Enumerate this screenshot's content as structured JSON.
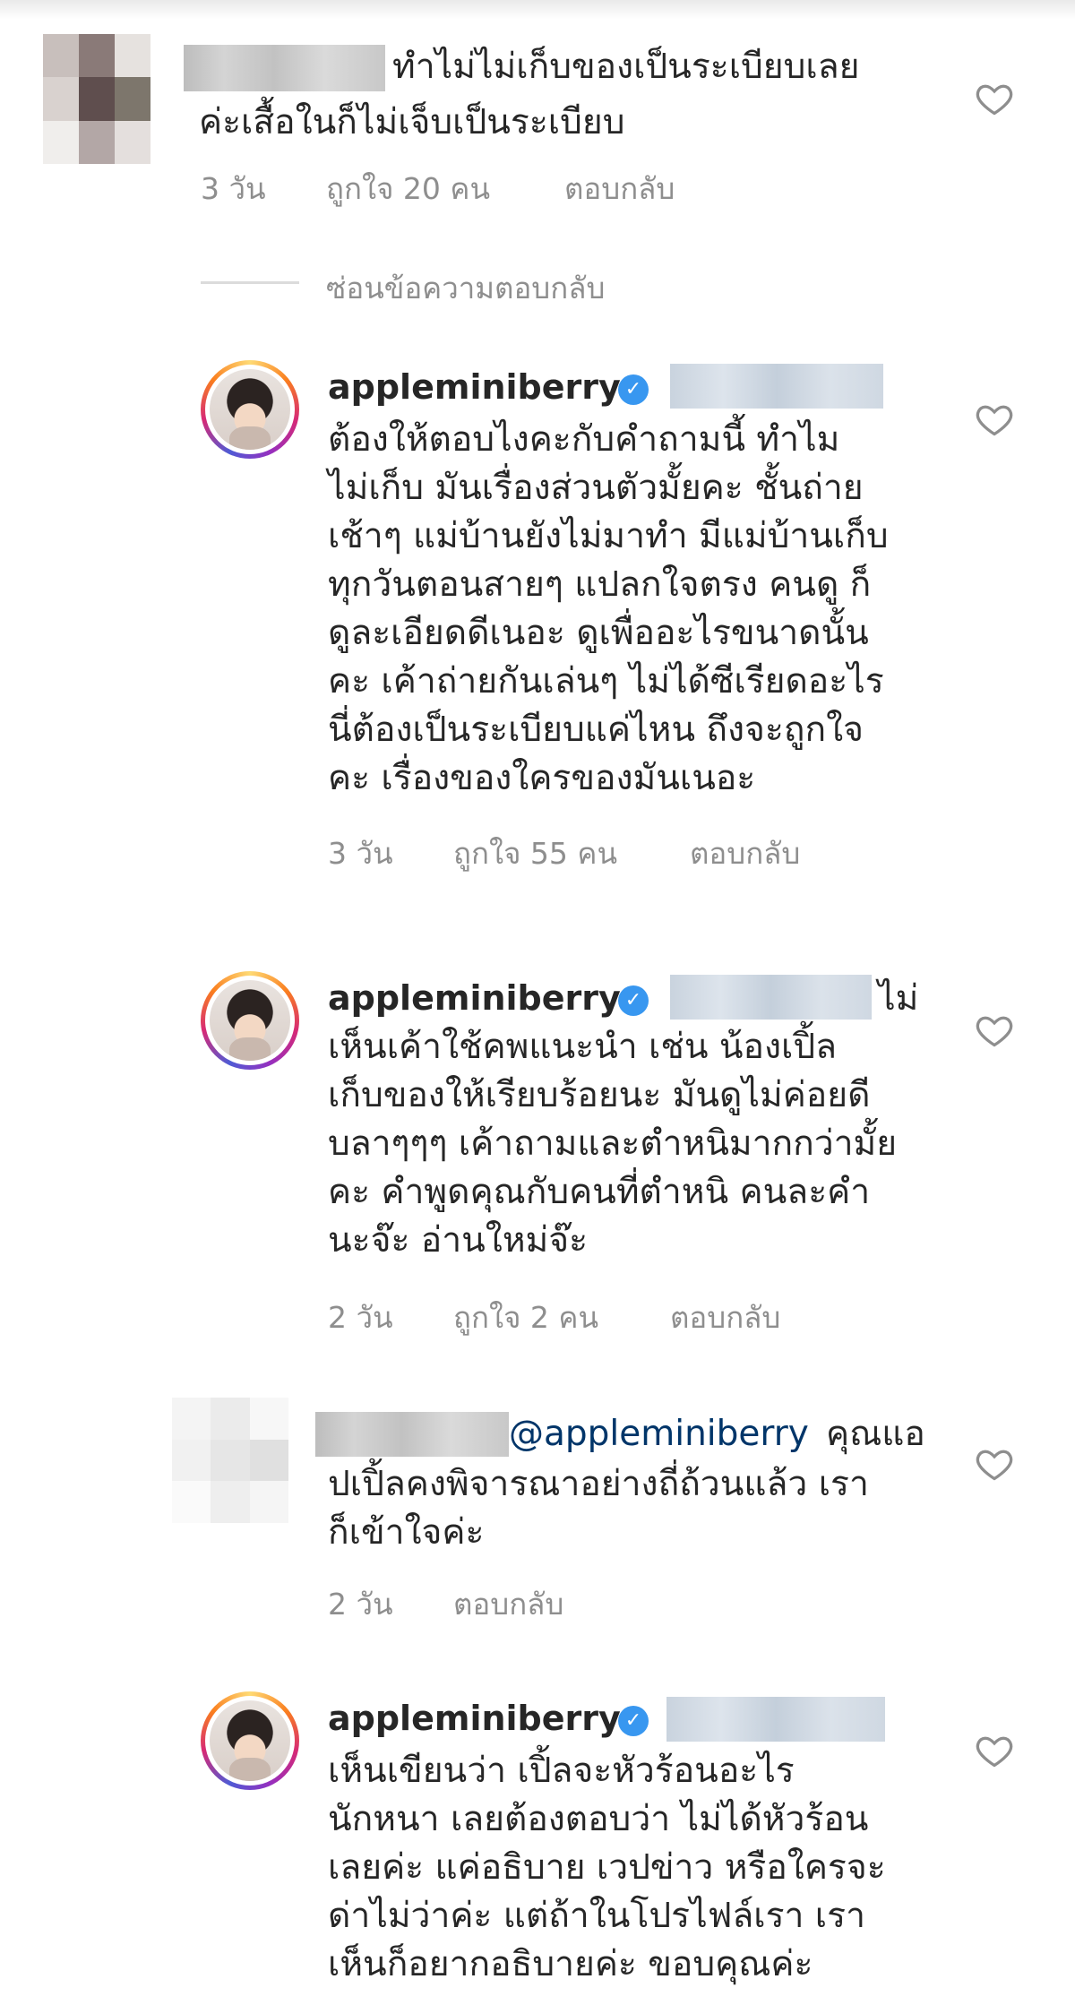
{
  "comments": [
    {
      "text_before": "ทำไม่ไม่เก็บของเป็นระเบียบเลย",
      "text_after": "ค่ะเสื้อในก็ไม่เจ็บเป็นระเบียบ",
      "time": "3 วัน",
      "likes": "ถูกใจ 20 คน",
      "reply": "ตอบกลับ"
    },
    {
      "username": "appleminiberry",
      "text": "ต้องให้ตอบไงคะกับคำถามนี้ ทำไม\nไม่เก็บ มันเรื่องส่วนตัวมั้ยคะ ชั้นถ่าย\nเช้าๆ แม่บ้านยังไม่มาทำ มีแม่บ้านเก็บ\nทุกวันตอนสายๆ แปลกใจตรง คนดู ก็\nดูละเอียดดีเนอะ ดูเพื่ออะไรขนาดนั้น\nคะ เค้าถ่ายกันเล่นๆ ไม่ได้ซีเรียดอะไร\nนี่ต้องเป็นระเบียบแค่ไหน ถึงจะถูกใจ\nคะ เรื่องของใครของมันเนอะ",
      "time": "3 วัน",
      "likes": "ถูกใจ 55 คน",
      "reply": "ตอบกลับ"
    },
    {
      "username": "appleminiberry",
      "text_first_line_end": "ไม่",
      "text": "เห็นเค้าใช้คพแนะนำ เช่น น้องเปิ้ล\nเก็บของให้เรียบร้อยนะ มันดูไม่ค่อยดี\nบลาๆๆๆ เค้าถามและตำหนิมากกว่ามั้ย\nคะ คำพูดคุณกับคนที่ตำหนิ คนละคำ\nนะจ๊ะ อ่านใหม่จ๊ะ",
      "time": "2 วัน",
      "likes": "ถูกใจ 2 คน",
      "reply": "ตอบกลับ"
    },
    {
      "mention": "@appleminiberry",
      "text_first_line_end": "คุณแอ",
      "text": "ปเปิ้ลคงพิจารณาอย่างถี่ถ้วนแล้ว เรา\nก็เข้าใจค่ะ",
      "time": "2 วัน",
      "reply": "ตอบกลับ"
    },
    {
      "username": "appleminiberry",
      "text": "เห็นเขียนว่า เปิ้ลจะหัวร้อนอะไร\nนักหนา เลยต้องตอบว่า ไม่ได้หัวร้อน\nเลยค่ะ แค่อธิบาย เวปข่าว หรือใครจะ\nด่าไม่ว่าค่ะ แต่ถ้าในโปรไฟล์เรา เรา\nเห็นก็อยากอธิบายค่ะ ขอบคุณค่ะ"
    }
  ],
  "hide_replies_label": "ซ่อนข้อความตอบกลับ",
  "icons": {
    "heart": "heart-outline-icon",
    "verified": "verified-badge-icon"
  },
  "colors": {
    "verified": "#3897f0",
    "mention": "#003569",
    "meta": "#8e8e8e"
  }
}
